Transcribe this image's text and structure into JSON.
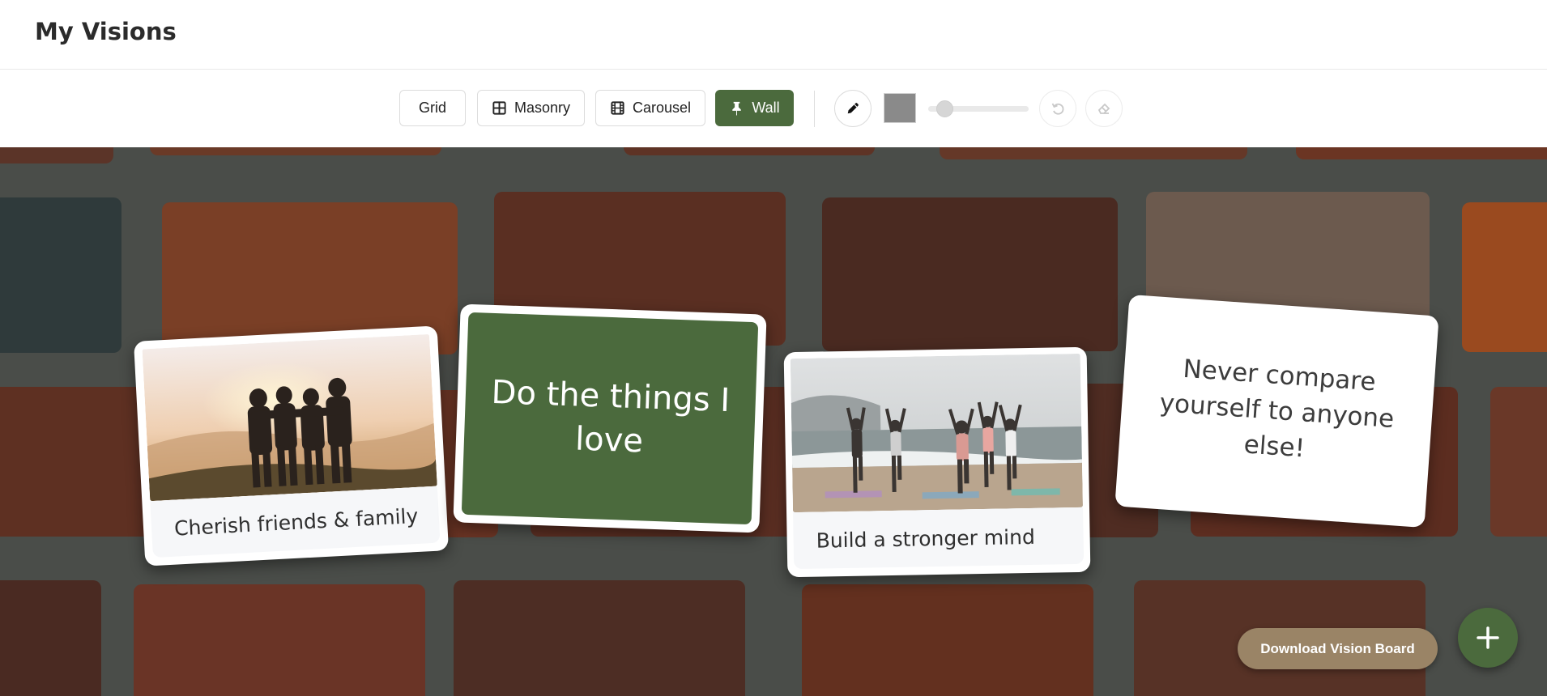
{
  "app": {
    "title": "My Visions"
  },
  "toolbar": {
    "layouts": [
      {
        "label": "Grid",
        "icon": "none",
        "active": false
      },
      {
        "label": "Masonry",
        "icon": "masonry-grid-icon",
        "active": false
      },
      {
        "label": "Carousel",
        "icon": "film-icon",
        "active": false
      },
      {
        "label": "Wall",
        "icon": "pin-icon",
        "active": true
      }
    ],
    "draw_tools": {
      "pen_icon": "pencil-icon",
      "color": "#8a8a8a",
      "brush_size_fraction": 0.1,
      "undo_icon": "undo-icon",
      "undo_enabled": false,
      "eraser_icon": "eraser-icon",
      "eraser_enabled": false
    }
  },
  "board": {
    "background": "brick-wall",
    "cards": [
      {
        "type": "image",
        "caption": "Cherish friends & family",
        "image": "friends-sunset-photo"
      },
      {
        "type": "quote",
        "style": "green",
        "text": "Do the things I love"
      },
      {
        "type": "image",
        "caption": "Build a stronger mind",
        "image": "beach-yoga-photo"
      },
      {
        "type": "quote",
        "style": "white",
        "text": "Never compare yourself to anyone else!"
      }
    ]
  },
  "actions": {
    "download_label": "Download Vision Board",
    "add_icon": "plus-icon"
  },
  "colors": {
    "accent_green": "#4b6a3d",
    "download_tan": "#9a8466"
  }
}
